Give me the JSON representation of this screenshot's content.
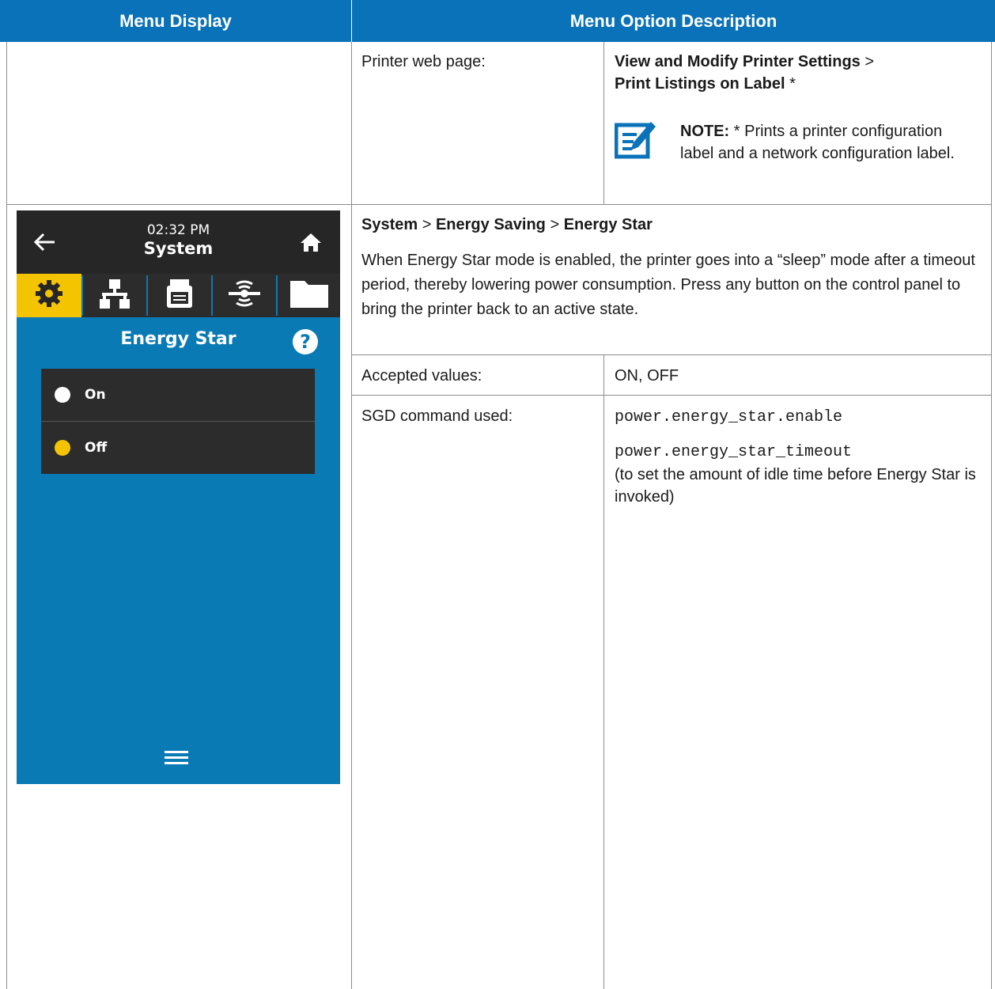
{
  "table": {
    "header_left": "Menu Display",
    "header_right": "Menu Option Description"
  },
  "row1": {
    "label": "Printer web page:",
    "path_part1": "View and Modify Printer Settings",
    "sep": " > ",
    "path_part2": "Print Listings on Label",
    "asterisk": " *",
    "note_label": "NOTE:",
    "note_text": " * Prints a printer configuration label and a network configuration label."
  },
  "row2": {
    "path_a": "System",
    "path_b": "Energy Saving",
    "path_c": "Energy Star",
    "sep": " > ",
    "description": "When Energy Star mode is enabled, the printer goes into a “sleep” mode after a timeout period, thereby lowering power consumption. Press any button on the control panel to bring the printer back to an active state.",
    "accepted_label": "Accepted values:",
    "accepted_value": "ON, OFF",
    "sgd_label": "SGD command used:",
    "sgd_cmd1": "power.energy_star.enable",
    "sgd_cmd2": "power.energy_star_timeout",
    "sgd_note": "(to set the amount of idle time before Energy Star is invoked)"
  },
  "device": {
    "time": "02:32 PM",
    "title": "System",
    "screen_title": "Energy Star",
    "options": [
      {
        "label": "On",
        "color": "#ffffff"
      },
      {
        "label": "Off",
        "color": "#f5c400"
      }
    ],
    "active_tab_color": "#f5c400",
    "icons": [
      "back-arrow-icon",
      "home-icon",
      "gear-icon",
      "network-icon",
      "printer-icon",
      "wireless-icon",
      "folder-icon",
      "help-icon",
      "menu-icon"
    ]
  }
}
